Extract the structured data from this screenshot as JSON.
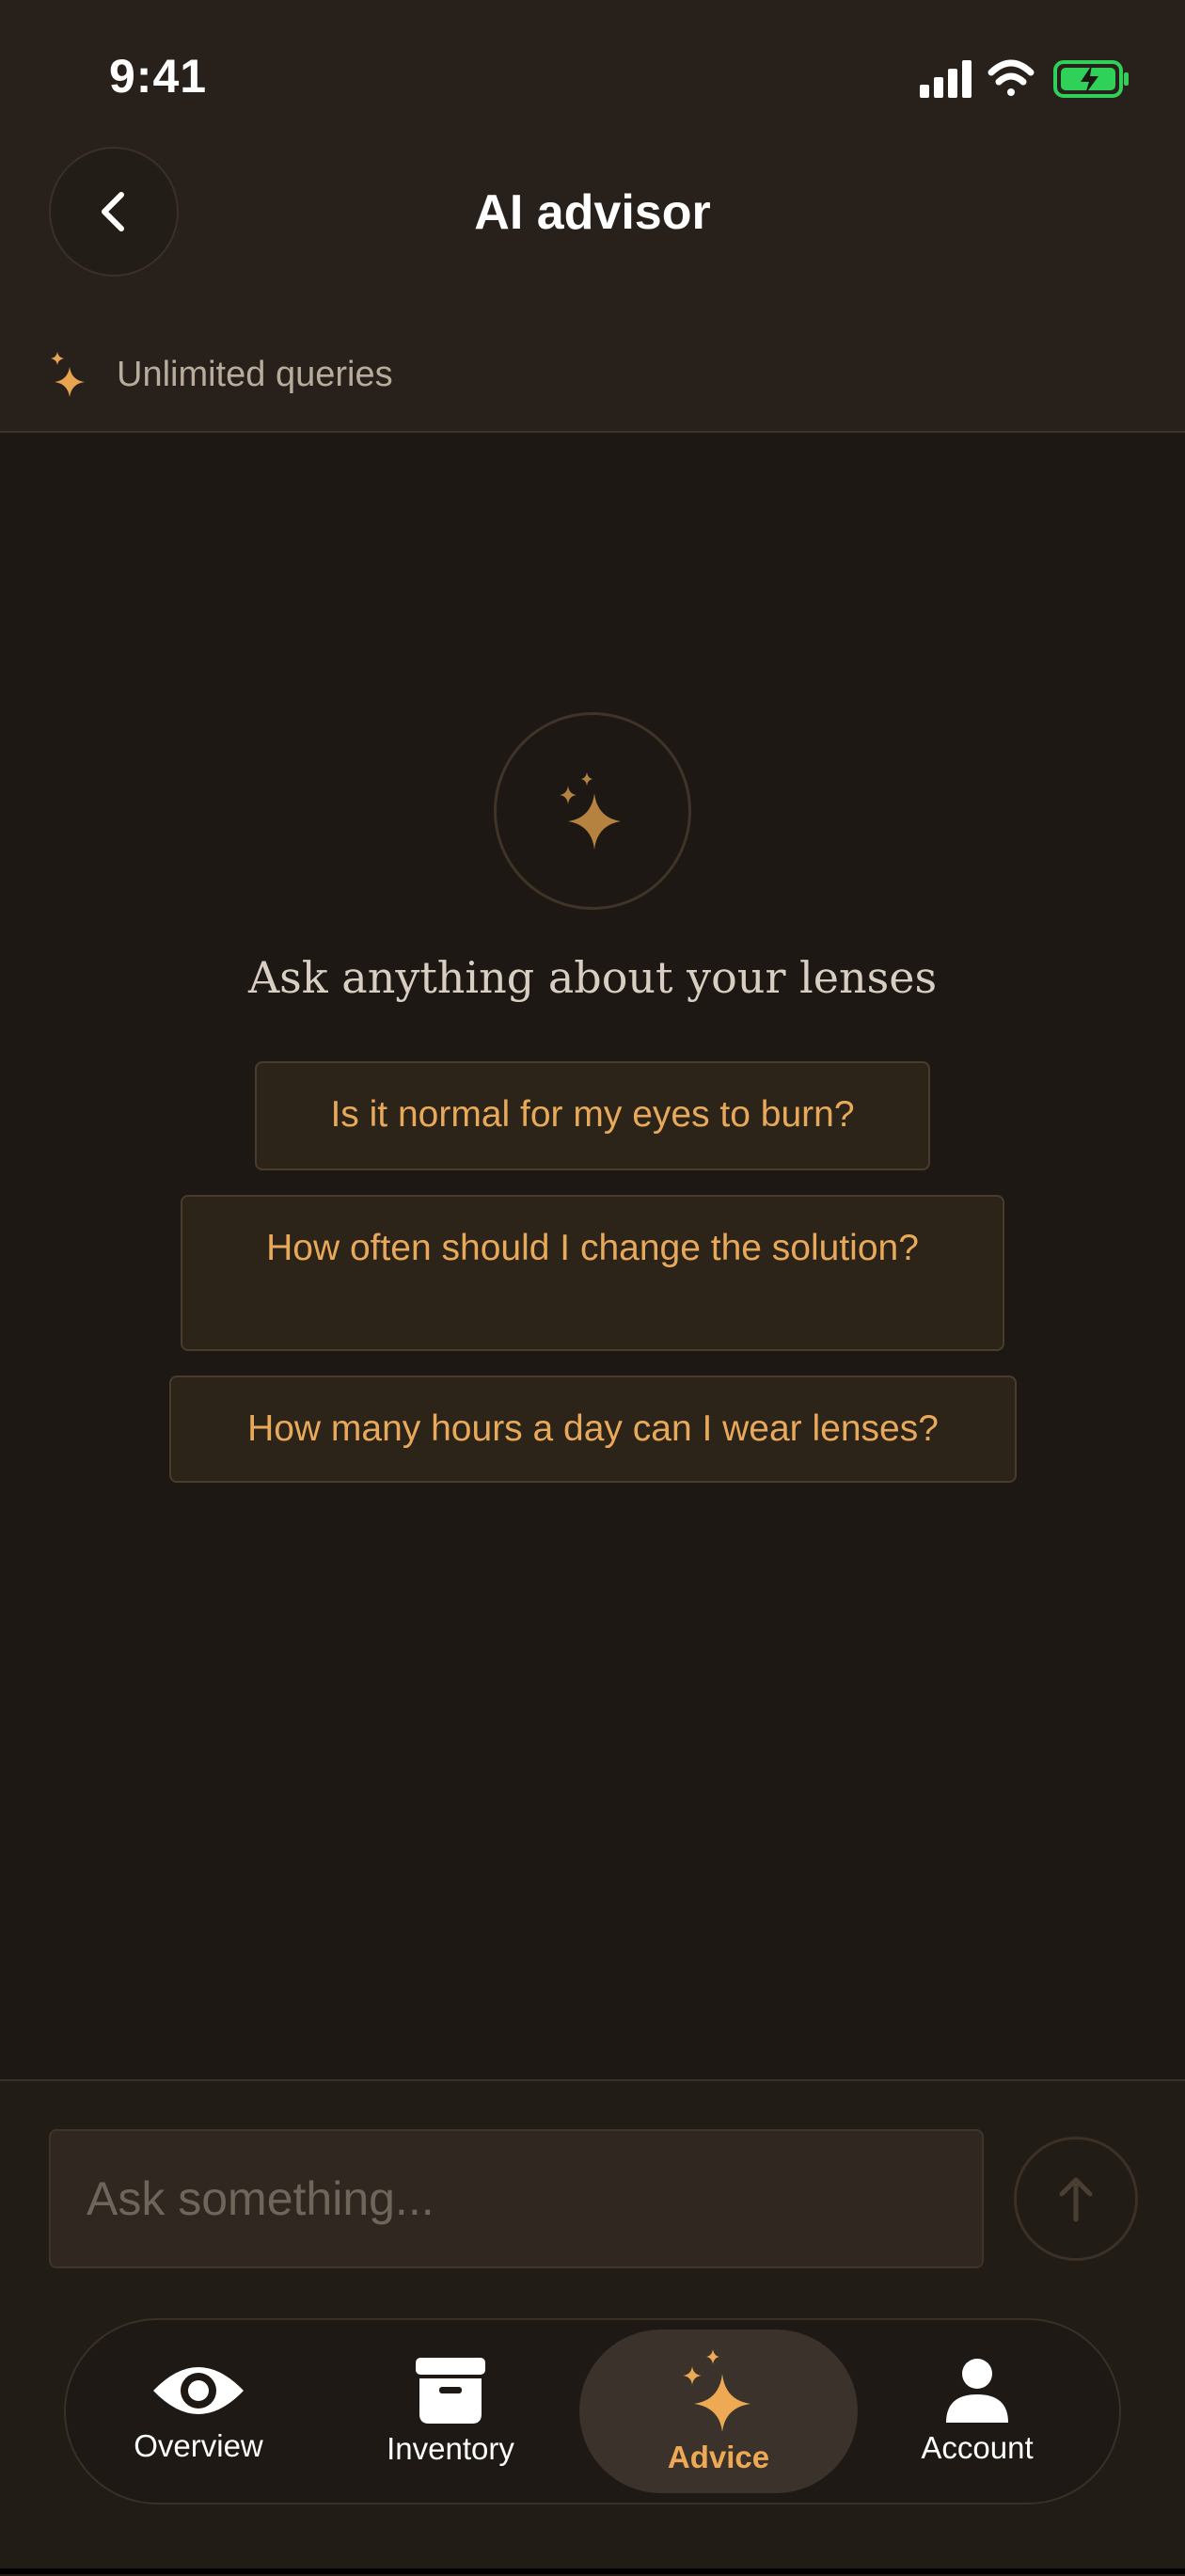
{
  "status_bar": {
    "time": "9:41",
    "icons": [
      "cellular-signal-icon",
      "wifi-icon",
      "battery-charging-icon"
    ],
    "battery_color": "#30d158"
  },
  "header": {
    "back_icon": "chevron-left-icon",
    "title": "AI advisor",
    "quota_icon": "sparkles-icon",
    "quota_label": "Unlimited queries"
  },
  "empty_state": {
    "icon": "sparkles-icon",
    "prompt": "Ask anything about your lenses",
    "suggestions": [
      "Is it normal for my eyes to burn?",
      "How often should I change the solution?",
      "How many hours a day can I wear lenses?"
    ]
  },
  "composer": {
    "placeholder": "Ask something...",
    "value": "",
    "send_icon": "arrow-up-icon"
  },
  "tabs": [
    {
      "label": "Overview",
      "icon": "eye-icon",
      "active": false
    },
    {
      "label": "Inventory",
      "icon": "archive-box-icon",
      "active": false
    },
    {
      "label": "Advice",
      "icon": "sparkles-icon",
      "active": true
    },
    {
      "label": "Account",
      "icon": "person-icon",
      "active": false
    }
  ],
  "colors": {
    "accent": "#eda954",
    "background": "#1d1814",
    "header_background": "#28211b"
  }
}
